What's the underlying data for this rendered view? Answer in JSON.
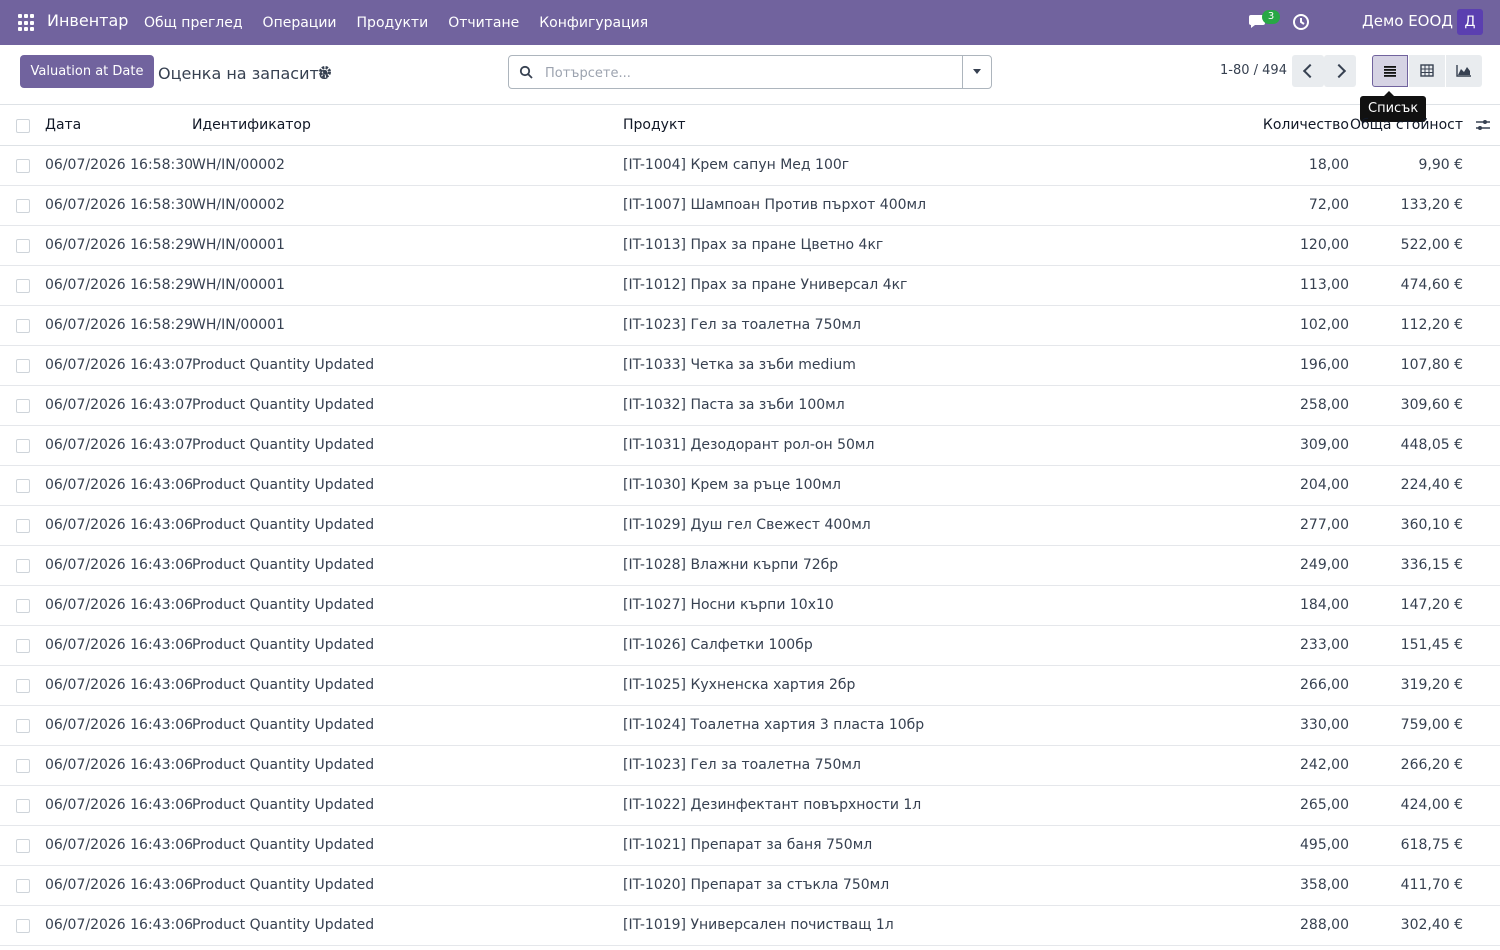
{
  "navbar": {
    "brand": "Инвентар",
    "menu": [
      "Общ преглед",
      "Операции",
      "Продукти",
      "Отчитане",
      "Конфигурация"
    ],
    "chat_count": "3",
    "company": "Демо ЕООД",
    "avatar_letter": "Д",
    "color": "#71639e"
  },
  "control": {
    "valuation_button": "Valuation at Date",
    "title": "Оценка на запасите",
    "search_placeholder": "Потърсете...",
    "pager": "1-80 / 494",
    "tooltip": "Списък"
  },
  "table": {
    "headers": {
      "date": "Дата",
      "reference": "Идентификатор",
      "product": "Продукт",
      "quantity": "Количество",
      "value": "Обща стойност"
    },
    "rows": [
      {
        "date": "06/07/2026 16:58:30",
        "ref": "WH/IN/00002",
        "product": "[IT-1004] Крем сапун Мед 100г",
        "qty": "18,00",
        "value": "9,90 €"
      },
      {
        "date": "06/07/2026 16:58:30",
        "ref": "WH/IN/00002",
        "product": "[IT-1007] Шампоан Против пърхот 400мл",
        "qty": "72,00",
        "value": "133,20 €"
      },
      {
        "date": "06/07/2026 16:58:29",
        "ref": "WH/IN/00001",
        "product": "[IT-1013] Прах за пране Цветно 4кг",
        "qty": "120,00",
        "value": "522,00 €"
      },
      {
        "date": "06/07/2026 16:58:29",
        "ref": "WH/IN/00001",
        "product": "[IT-1012] Прах за пране Универсал 4кг",
        "qty": "113,00",
        "value": "474,60 €"
      },
      {
        "date": "06/07/2026 16:58:29",
        "ref": "WH/IN/00001",
        "product": "[IT-1023] Гел за тоалетна 750мл",
        "qty": "102,00",
        "value": "112,20 €"
      },
      {
        "date": "06/07/2026 16:43:07",
        "ref": "Product Quantity Updated",
        "product": "[IT-1033] Четка за зъби medium",
        "qty": "196,00",
        "value": "107,80 €"
      },
      {
        "date": "06/07/2026 16:43:07",
        "ref": "Product Quantity Updated",
        "product": "[IT-1032] Паста за зъби 100мл",
        "qty": "258,00",
        "value": "309,60 €"
      },
      {
        "date": "06/07/2026 16:43:07",
        "ref": "Product Quantity Updated",
        "product": "[IT-1031] Дезодорант рол-он 50мл",
        "qty": "309,00",
        "value": "448,05 €"
      },
      {
        "date": "06/07/2026 16:43:06",
        "ref": "Product Quantity Updated",
        "product": "[IT-1030] Крем за ръце 100мл",
        "qty": "204,00",
        "value": "224,40 €"
      },
      {
        "date": "06/07/2026 16:43:06",
        "ref": "Product Quantity Updated",
        "product": "[IT-1029] Душ гел Свежест 400мл",
        "qty": "277,00",
        "value": "360,10 €"
      },
      {
        "date": "06/07/2026 16:43:06",
        "ref": "Product Quantity Updated",
        "product": "[IT-1028] Влажни кърпи 72бр",
        "qty": "249,00",
        "value": "336,15 €"
      },
      {
        "date": "06/07/2026 16:43:06",
        "ref": "Product Quantity Updated",
        "product": "[IT-1027] Носни кърпи 10x10",
        "qty": "184,00",
        "value": "147,20 €"
      },
      {
        "date": "06/07/2026 16:43:06",
        "ref": "Product Quantity Updated",
        "product": "[IT-1026] Салфетки 100бр",
        "qty": "233,00",
        "value": "151,45 €"
      },
      {
        "date": "06/07/2026 16:43:06",
        "ref": "Product Quantity Updated",
        "product": "[IT-1025] Кухненска хартия 2бр",
        "qty": "266,00",
        "value": "319,20 €"
      },
      {
        "date": "06/07/2026 16:43:06",
        "ref": "Product Quantity Updated",
        "product": "[IT-1024] Тоалетна хартия 3 пласта 10бр",
        "qty": "330,00",
        "value": "759,00 €"
      },
      {
        "date": "06/07/2026 16:43:06",
        "ref": "Product Quantity Updated",
        "product": "[IT-1023] Гел за тоалетна 750мл",
        "qty": "242,00",
        "value": "266,20 €"
      },
      {
        "date": "06/07/2026 16:43:06",
        "ref": "Product Quantity Updated",
        "product": "[IT-1022] Дезинфектант повърхности 1л",
        "qty": "265,00",
        "value": "424,00 €"
      },
      {
        "date": "06/07/2026 16:43:06",
        "ref": "Product Quantity Updated",
        "product": "[IT-1021] Препарат за баня 750мл",
        "qty": "495,00",
        "value": "618,75 €"
      },
      {
        "date": "06/07/2026 16:43:06",
        "ref": "Product Quantity Updated",
        "product": "[IT-1020] Препарат за стъкла 750мл",
        "qty": "358,00",
        "value": "411,70 €"
      },
      {
        "date": "06/07/2026 16:43:06",
        "ref": "Product Quantity Updated",
        "product": "[IT-1019] Универсален почистващ 1л",
        "qty": "288,00",
        "value": "302,40 €"
      }
    ]
  }
}
